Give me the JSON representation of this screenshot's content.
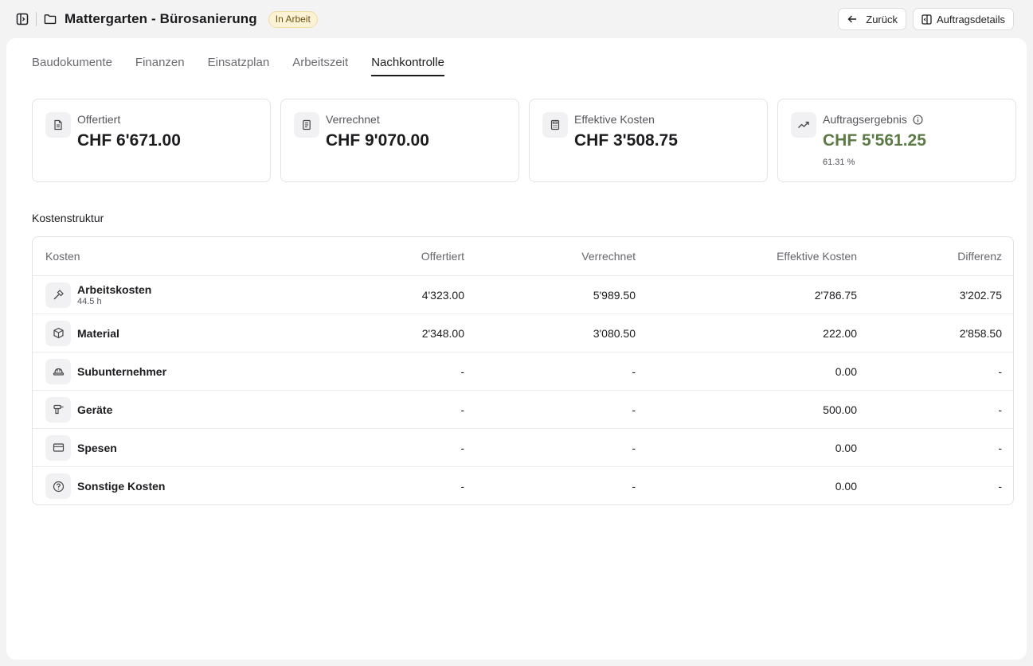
{
  "header": {
    "sidebar_toggle_icon": "sidebar-toggle-icon",
    "folder_icon": "folder-icon",
    "title": "Mattergarten - Bürosanierung",
    "status_badge": "In Arbeit",
    "back_label": "Zurück",
    "details_label": "Auftragsdetails"
  },
  "tabs": [
    {
      "label": "Baudokumente",
      "active": false
    },
    {
      "label": "Finanzen",
      "active": false
    },
    {
      "label": "Einsatzplan",
      "active": false
    },
    {
      "label": "Arbeitszeit",
      "active": false
    },
    {
      "label": "Nachkontrolle",
      "active": true
    }
  ],
  "kpis": [
    {
      "icon": "document-icon",
      "label": "Offertiert",
      "value": "CHF 6'671.00"
    },
    {
      "icon": "receipt-icon",
      "label": "Verrechnet",
      "value": "CHF 9'070.00"
    },
    {
      "icon": "calculator-icon",
      "label": "Effektive Kosten",
      "value": "CHF 3'508.75"
    },
    {
      "icon": "trend-up-icon",
      "label": "Auftragsergebnis",
      "value": "CHF 5'561.25",
      "sub": "61.31 %",
      "value_color": "#5b7a45"
    }
  ],
  "cost_structure": {
    "title": "Kostenstruktur",
    "columns": [
      "Kosten",
      "Offertiert",
      "Verrechnet",
      "Effektive Kosten",
      "Differenz"
    ],
    "rows": [
      {
        "icon": "hammer-icon",
        "name": "Arbeitskosten",
        "sub": "44.5 h",
        "offertiert": "4'323.00",
        "verrechnet": "5'989.50",
        "effektiv": "2'786.75",
        "differenz": "3'202.75"
      },
      {
        "icon": "box-icon",
        "name": "Material",
        "sub": "",
        "offertiert": "2'348.00",
        "verrechnet": "3'080.50",
        "effektiv": "222.00",
        "differenz": "2'858.50"
      },
      {
        "icon": "hardhat-icon",
        "name": "Subunternehmer",
        "sub": "",
        "offertiert": "-",
        "verrechnet": "-",
        "effektiv": "0.00",
        "differenz": "-"
      },
      {
        "icon": "drill-icon",
        "name": "Geräte",
        "sub": "",
        "offertiert": "-",
        "verrechnet": "-",
        "effektiv": "500.00",
        "differenz": "-"
      },
      {
        "icon": "credit-card-icon",
        "name": "Spesen",
        "sub": "",
        "offertiert": "-",
        "verrechnet": "-",
        "effektiv": "0.00",
        "differenz": "-"
      },
      {
        "icon": "help-circle-icon",
        "name": "Sonstige Kosten",
        "sub": "",
        "offertiert": "-",
        "verrechnet": "-",
        "effektiv": "0.00",
        "differenz": "-"
      }
    ]
  }
}
